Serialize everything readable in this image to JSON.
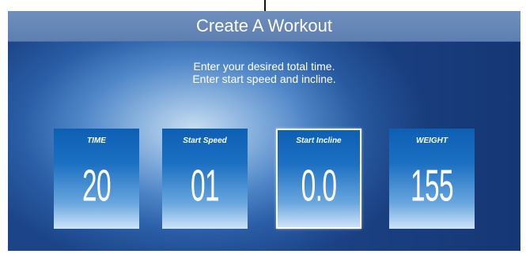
{
  "header": {
    "title": "Create A Workout"
  },
  "instructions": {
    "line1": "Enter your desired total time.",
    "line2": "Enter start speed and incline."
  },
  "tiles": [
    {
      "label": "TIME",
      "value": "20",
      "selected": false
    },
    {
      "label": "Start Speed",
      "value": "01",
      "selected": false
    },
    {
      "label": "Start Incline",
      "value": "0.0",
      "selected": true
    },
    {
      "label": "WEIGHT",
      "value": "155",
      "selected": false
    }
  ],
  "colors": {
    "title_bar": "#6b8bbb",
    "tile_top": "#0d5fb4",
    "tile_bottom": "#cfe4f7",
    "background_center": "#c8def2",
    "background_edge": "#1c4488"
  }
}
